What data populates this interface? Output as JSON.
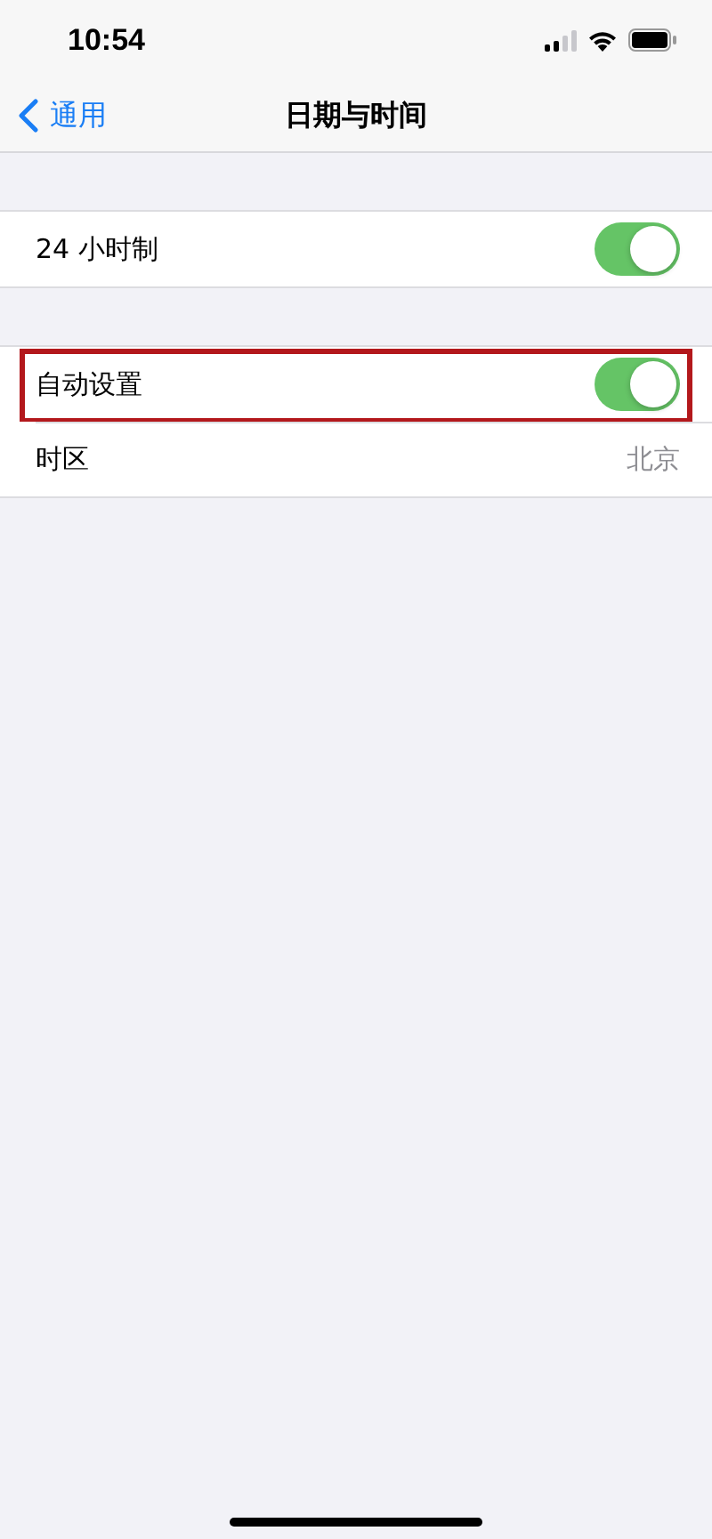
{
  "status_bar": {
    "time": "10:54"
  },
  "nav_bar": {
    "back_label": "通用",
    "title": "日期与时间"
  },
  "groups": [
    {
      "rows": [
        {
          "kind": "toggle",
          "label": "24 小时制",
          "on": true,
          "highlighted": false
        }
      ]
    },
    {
      "rows": [
        {
          "kind": "toggle",
          "label": "自动设置",
          "on": true,
          "highlighted": true
        },
        {
          "kind": "value",
          "label": "时区",
          "value": "北京",
          "highlighted": false
        }
      ]
    }
  ]
}
